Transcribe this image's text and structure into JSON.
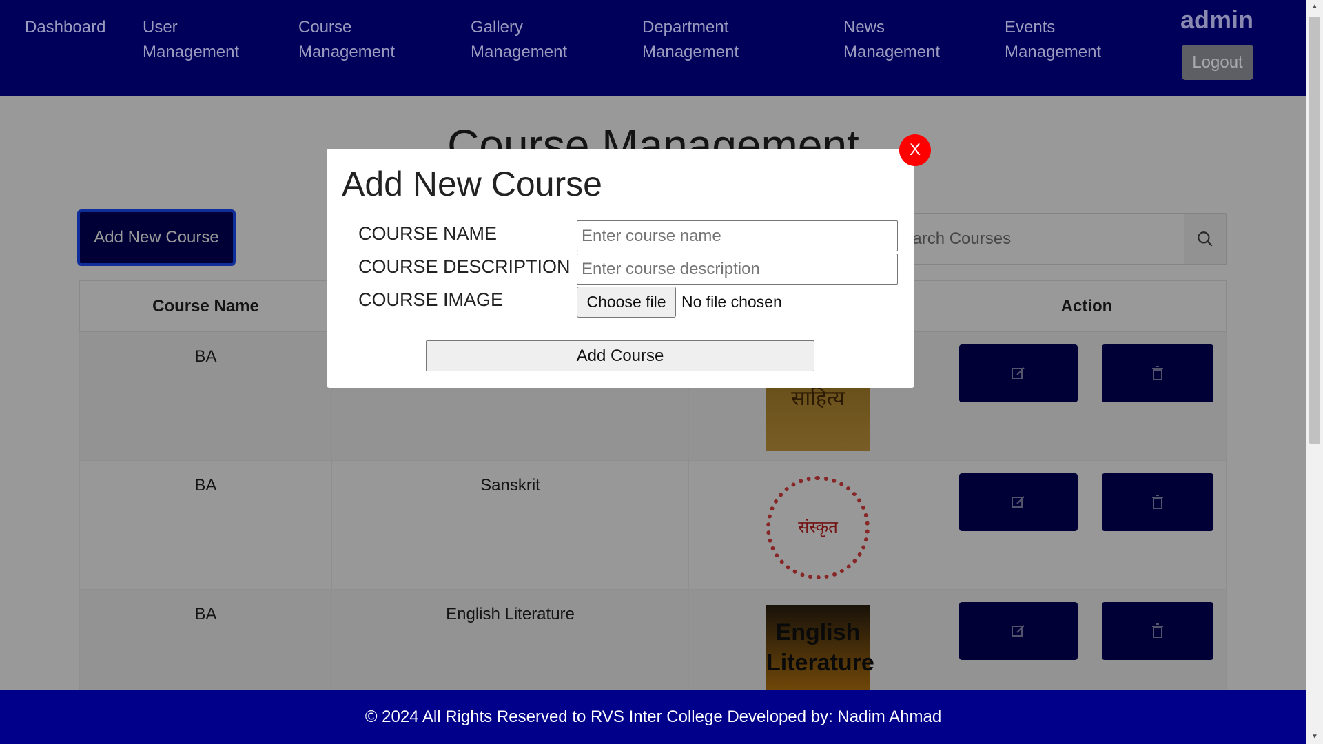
{
  "nav": {
    "items": [
      {
        "label": "Dashboard"
      },
      {
        "label": "User Management"
      },
      {
        "label": "Course Management"
      },
      {
        "label": "Gallery Management"
      },
      {
        "label": "Department Management"
      },
      {
        "label": "News Management"
      },
      {
        "label": "Events Management"
      }
    ],
    "user": "admin",
    "logout_label": "Logout"
  },
  "page": {
    "title": "Course Management",
    "add_button_label": "Add New Course",
    "search_placeholder": "Search Courses"
  },
  "table": {
    "headers": [
      "Course Name",
      "",
      "",
      "Action"
    ],
    "rows": [
      {
        "name": "BA",
        "description": "",
        "image_alt": "साहित्य"
      },
      {
        "name": "BA",
        "description": "Sanskrit",
        "image_alt": "संस्कृत"
      },
      {
        "name": "BA",
        "description": "English Literature",
        "image_alt": "English Literature"
      }
    ]
  },
  "modal": {
    "title": "Add New Course",
    "close_label": "X",
    "fields": {
      "name_label": "COURSE NAME",
      "name_placeholder": "Enter course name",
      "description_label": "COURSE DESCRIPTION",
      "description_placeholder": "Enter course description",
      "image_label": "COURSE IMAGE",
      "file_button_label": "Choose file",
      "file_status": "No file chosen"
    },
    "submit_label": "Add Course"
  },
  "footer": {
    "text": "© 2024 All Rights Reserved to RVS Inter College Developed by: Nadim Ahmad"
  },
  "colors": {
    "nav_bg": "#00005a",
    "footer_bg": "#00008b",
    "action_btn": "#00005a",
    "close_btn": "#ff0000"
  },
  "icons": [
    "search-icon",
    "edit-icon",
    "trash-icon"
  ]
}
